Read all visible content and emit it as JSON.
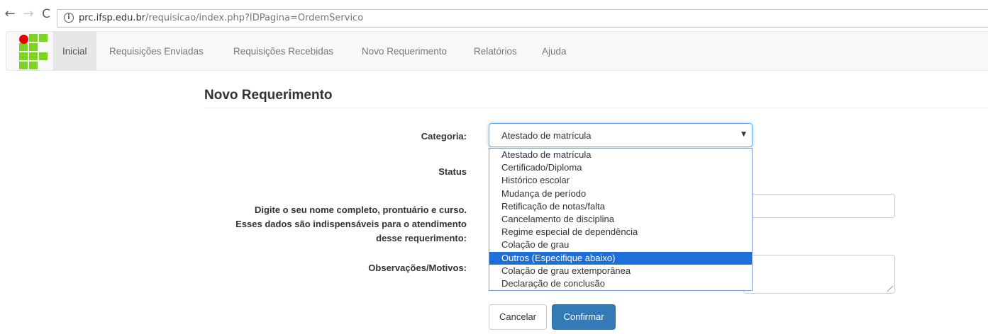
{
  "browser": {
    "back_icon": "←",
    "forward_icon": "→",
    "reload_icon": "C",
    "info_icon": "i",
    "url_host": "prc.ifsp.edu.br",
    "url_path": "/requisicao/index.php?IDPagina=OrdemServico"
  },
  "navbar": {
    "items": [
      {
        "label": "Inicial"
      },
      {
        "label": "Requisições Enviadas"
      },
      {
        "label": "Requisições Recebidas"
      },
      {
        "label": "Novo Requerimento"
      },
      {
        "label": "Relatórios"
      },
      {
        "label": "Ajuda"
      }
    ],
    "logo_colors": {
      "green": "#7ed321",
      "red": "#e60000"
    }
  },
  "page": {
    "title": "Novo Requerimento"
  },
  "form": {
    "categoria_label": "Categoria:",
    "categoria_value": "Atestado de matrícula",
    "caret_icon": "▼",
    "status_label": "Status",
    "nome_label_lines": [
      "Digite o seu nome completo, prontuário e curso.",
      "Esses dados são indispensáveis para o atendimento",
      "desse requerimento:"
    ],
    "obs_label": "Observações/Motivos:",
    "options": [
      "Atestado de matrícula",
      "Certificado/Diploma",
      "Histórico escolar",
      "Mudança de período",
      "Retificação de notas/falta",
      "Cancelamento de disciplina",
      "Regime especial de dependência",
      "Colação de grau",
      "Outros (Especifique abaixo)",
      "Colação de grau extemporânea",
      "Declaração de conclusão"
    ],
    "highlighted_option": "Outros (Especifique abaixo)",
    "cancel_label": "Cancelar",
    "confirm_label": "Confirmar",
    "accent_color": "#337ab7",
    "highlight_color": "#1e6fd9"
  }
}
